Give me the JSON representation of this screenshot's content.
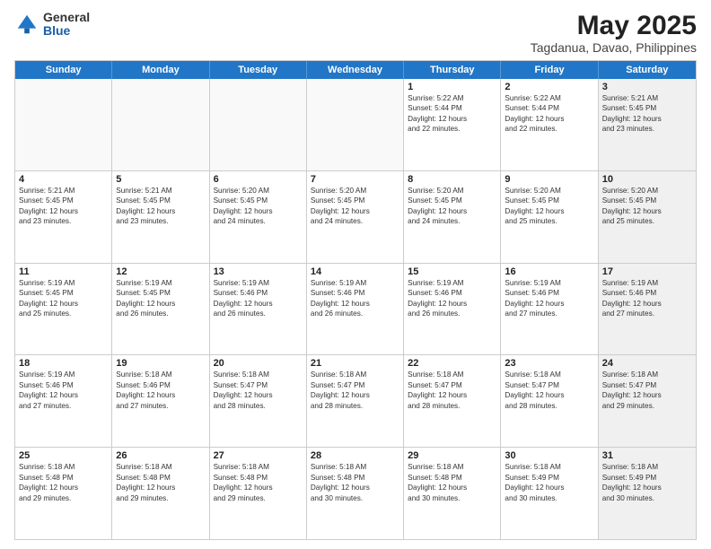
{
  "logo": {
    "general": "General",
    "blue": "Blue"
  },
  "title": "May 2025",
  "subtitle": "Tagdanua, Davao, Philippines",
  "days": [
    "Sunday",
    "Monday",
    "Tuesday",
    "Wednesday",
    "Thursday",
    "Friday",
    "Saturday"
  ],
  "rows": [
    [
      {
        "day": "",
        "lines": [],
        "empty": true
      },
      {
        "day": "",
        "lines": [],
        "empty": true
      },
      {
        "day": "",
        "lines": [],
        "empty": true
      },
      {
        "day": "",
        "lines": [],
        "empty": true
      },
      {
        "day": "1",
        "lines": [
          "Sunrise: 5:22 AM",
          "Sunset: 5:44 PM",
          "Daylight: 12 hours",
          "and 22 minutes."
        ]
      },
      {
        "day": "2",
        "lines": [
          "Sunrise: 5:22 AM",
          "Sunset: 5:44 PM",
          "Daylight: 12 hours",
          "and 22 minutes."
        ]
      },
      {
        "day": "3",
        "lines": [
          "Sunrise: 5:21 AM",
          "Sunset: 5:45 PM",
          "Daylight: 12 hours",
          "and 23 minutes."
        ],
        "shaded": true
      }
    ],
    [
      {
        "day": "4",
        "lines": [
          "Sunrise: 5:21 AM",
          "Sunset: 5:45 PM",
          "Daylight: 12 hours",
          "and 23 minutes."
        ]
      },
      {
        "day": "5",
        "lines": [
          "Sunrise: 5:21 AM",
          "Sunset: 5:45 PM",
          "Daylight: 12 hours",
          "and 23 minutes."
        ]
      },
      {
        "day": "6",
        "lines": [
          "Sunrise: 5:20 AM",
          "Sunset: 5:45 PM",
          "Daylight: 12 hours",
          "and 24 minutes."
        ]
      },
      {
        "day": "7",
        "lines": [
          "Sunrise: 5:20 AM",
          "Sunset: 5:45 PM",
          "Daylight: 12 hours",
          "and 24 minutes."
        ]
      },
      {
        "day": "8",
        "lines": [
          "Sunrise: 5:20 AM",
          "Sunset: 5:45 PM",
          "Daylight: 12 hours",
          "and 24 minutes."
        ]
      },
      {
        "day": "9",
        "lines": [
          "Sunrise: 5:20 AM",
          "Sunset: 5:45 PM",
          "Daylight: 12 hours",
          "and 25 minutes."
        ]
      },
      {
        "day": "10",
        "lines": [
          "Sunrise: 5:20 AM",
          "Sunset: 5:45 PM",
          "Daylight: 12 hours",
          "and 25 minutes."
        ],
        "shaded": true
      }
    ],
    [
      {
        "day": "11",
        "lines": [
          "Sunrise: 5:19 AM",
          "Sunset: 5:45 PM",
          "Daylight: 12 hours",
          "and 25 minutes."
        ]
      },
      {
        "day": "12",
        "lines": [
          "Sunrise: 5:19 AM",
          "Sunset: 5:45 PM",
          "Daylight: 12 hours",
          "and 26 minutes."
        ]
      },
      {
        "day": "13",
        "lines": [
          "Sunrise: 5:19 AM",
          "Sunset: 5:46 PM",
          "Daylight: 12 hours",
          "and 26 minutes."
        ]
      },
      {
        "day": "14",
        "lines": [
          "Sunrise: 5:19 AM",
          "Sunset: 5:46 PM",
          "Daylight: 12 hours",
          "and 26 minutes."
        ]
      },
      {
        "day": "15",
        "lines": [
          "Sunrise: 5:19 AM",
          "Sunset: 5:46 PM",
          "Daylight: 12 hours",
          "and 26 minutes."
        ]
      },
      {
        "day": "16",
        "lines": [
          "Sunrise: 5:19 AM",
          "Sunset: 5:46 PM",
          "Daylight: 12 hours",
          "and 27 minutes."
        ]
      },
      {
        "day": "17",
        "lines": [
          "Sunrise: 5:19 AM",
          "Sunset: 5:46 PM",
          "Daylight: 12 hours",
          "and 27 minutes."
        ],
        "shaded": true
      }
    ],
    [
      {
        "day": "18",
        "lines": [
          "Sunrise: 5:19 AM",
          "Sunset: 5:46 PM",
          "Daylight: 12 hours",
          "and 27 minutes."
        ]
      },
      {
        "day": "19",
        "lines": [
          "Sunrise: 5:18 AM",
          "Sunset: 5:46 PM",
          "Daylight: 12 hours",
          "and 27 minutes."
        ]
      },
      {
        "day": "20",
        "lines": [
          "Sunrise: 5:18 AM",
          "Sunset: 5:47 PM",
          "Daylight: 12 hours",
          "and 28 minutes."
        ]
      },
      {
        "day": "21",
        "lines": [
          "Sunrise: 5:18 AM",
          "Sunset: 5:47 PM",
          "Daylight: 12 hours",
          "and 28 minutes."
        ]
      },
      {
        "day": "22",
        "lines": [
          "Sunrise: 5:18 AM",
          "Sunset: 5:47 PM",
          "Daylight: 12 hours",
          "and 28 minutes."
        ]
      },
      {
        "day": "23",
        "lines": [
          "Sunrise: 5:18 AM",
          "Sunset: 5:47 PM",
          "Daylight: 12 hours",
          "and 28 minutes."
        ]
      },
      {
        "day": "24",
        "lines": [
          "Sunrise: 5:18 AM",
          "Sunset: 5:47 PM",
          "Daylight: 12 hours",
          "and 29 minutes."
        ],
        "shaded": true
      }
    ],
    [
      {
        "day": "25",
        "lines": [
          "Sunrise: 5:18 AM",
          "Sunset: 5:48 PM",
          "Daylight: 12 hours",
          "and 29 minutes."
        ]
      },
      {
        "day": "26",
        "lines": [
          "Sunrise: 5:18 AM",
          "Sunset: 5:48 PM",
          "Daylight: 12 hours",
          "and 29 minutes."
        ]
      },
      {
        "day": "27",
        "lines": [
          "Sunrise: 5:18 AM",
          "Sunset: 5:48 PM",
          "Daylight: 12 hours",
          "and 29 minutes."
        ]
      },
      {
        "day": "28",
        "lines": [
          "Sunrise: 5:18 AM",
          "Sunset: 5:48 PM",
          "Daylight: 12 hours",
          "and 30 minutes."
        ]
      },
      {
        "day": "29",
        "lines": [
          "Sunrise: 5:18 AM",
          "Sunset: 5:48 PM",
          "Daylight: 12 hours",
          "and 30 minutes."
        ]
      },
      {
        "day": "30",
        "lines": [
          "Sunrise: 5:18 AM",
          "Sunset: 5:49 PM",
          "Daylight: 12 hours",
          "and 30 minutes."
        ]
      },
      {
        "day": "31",
        "lines": [
          "Sunrise: 5:18 AM",
          "Sunset: 5:49 PM",
          "Daylight: 12 hours",
          "and 30 minutes."
        ],
        "shaded": true
      }
    ]
  ]
}
